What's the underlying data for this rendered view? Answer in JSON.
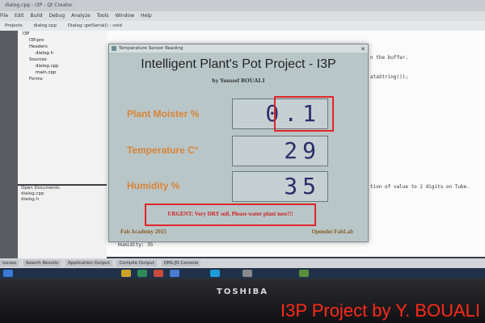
{
  "screen": {
    "window_title": "dialog.cpp - I3P - Qt Creator",
    "menu": [
      "File",
      "Edit",
      "Build",
      "Debug",
      "Analyze",
      "Tools",
      "Window",
      "Help"
    ],
    "toolbar": [
      "Projects",
      "dialog.cpp",
      "Dialog::getSerial() : void"
    ],
    "project_tree": [
      {
        "label": "I3P",
        "level": 1
      },
      {
        "label": "I3P.pro",
        "level": 2
      },
      {
        "label": "Headers",
        "level": 2
      },
      {
        "label": "dialog.h",
        "level": 3
      },
      {
        "label": "Sources",
        "level": 2
      },
      {
        "label": "dialog.cpp",
        "level": 3
      },
      {
        "label": "main.cpp",
        "level": 3
      },
      {
        "label": "Forms",
        "level": 2
      }
    ],
    "open_docs_title": "Open Documents",
    "open_docs": [
      "dialog.cpp",
      "dialog.h"
    ],
    "editor_right_fragments": [
      "n the buffer.",
      "ataString());",
      "tion of value to 2 digits on Tube."
    ],
    "output_line": "Humidity:  35",
    "bottom_tabs": [
      "Issues",
      "Search Results",
      "Application Output",
      "Compile Output",
      "QML/JS Console"
    ]
  },
  "dialog": {
    "title": "Temperature Sensor Reading",
    "heading": "Intelligent Plant's Pot Project - I3P",
    "byline": "by Youssef BOUALI",
    "fields": [
      {
        "label": "Plant Moister %",
        "value": "0.1"
      },
      {
        "label": "Temperature C°",
        "value": "29"
      },
      {
        "label": "Humidity %",
        "value": "35"
      }
    ],
    "alert": "URGENT: Very DRY soil, Please water plant now!!!",
    "footer_left": "Fab Academy 2015",
    "footer_right": "Opendot FabLab"
  },
  "laptop_brand": "TOSHIBA",
  "watermark": "I3P Project by Y. BOUALI",
  "colors": {
    "label_orange": "#d88437",
    "alert_red": "#e0262a",
    "lcd_digits": "#2a2f6a",
    "watermark_red": "#ff2a1a"
  }
}
